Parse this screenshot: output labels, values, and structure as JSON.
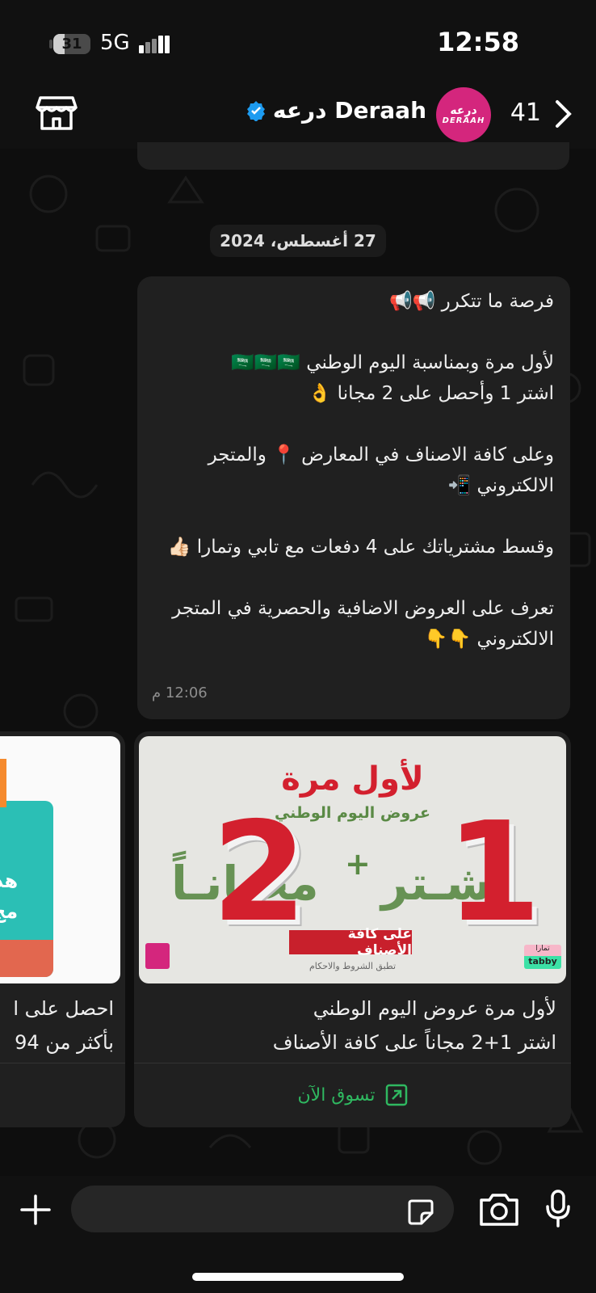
{
  "status_bar": {
    "battery": "31",
    "battery_percent": 31,
    "network": "5G",
    "time": "12:58"
  },
  "header": {
    "title": "Deraah درعه",
    "avatar_ar": "درعه",
    "avatar_en": "DERAAH",
    "unread_count": "41",
    "icons": [
      "store-icon",
      "verified-badge-icon",
      "back-chevron-icon"
    ]
  },
  "date_chip": "27 أغسطس، 2024",
  "message": {
    "lines": [
      "فرصة ما تتكرر 📢📢",
      "",
      "لأول مرة وبمناسبة اليوم الوطني 🇸🇦🇸🇦🇸🇦",
      "اشتر 1 وأحصل على 2 مجانا 👌",
      "",
      "وعلى كافة الاصناف في المعارض 📍 والمتجر الالكتروني 📲",
      "",
      "وقسط مشترياتك على 4 دفعات مع تابي وتمارا 👍🏻",
      "",
      "تعرف على العروض الاضافية والحصرية في المتجر الالكتروني 👇👇"
    ],
    "time": "12:06 م"
  },
  "cards": [
    {
      "promo": {
        "title": "لأول مرة",
        "subtitle": "عروض اليوم الوطني",
        "word_buy": "اشـتر",
        "num_buy": "1",
        "plus": "+",
        "word_free": "مجـانـاً",
        "num_free": "2",
        "all_categories": "على كافة الأصناف",
        "terms": "تطبق الشروط والاحكام",
        "tabby_top": "تمارا",
        "tabby": "tabby"
      },
      "caption_line1": "لأول مرة عروض اليوم الوطني",
      "caption_line2": "اشتر 1+2 مجاناً على كافة الأصناف",
      "cta_label": "تسوق الآن"
    },
    {
      "promo_text": "هد\nمج",
      "caption_line1": "احصل على ا",
      "caption_line2": "بأكثر من 94"
    }
  ],
  "composer": {
    "icons": [
      "plus-icon",
      "sticker-icon",
      "camera-icon",
      "microphone-icon"
    ]
  },
  "colors": {
    "background": "#0b0b0b",
    "bubble": "#202020",
    "accent_green": "#2fb860",
    "brand_pink": "#d4267d",
    "promo_red": "#d3202e",
    "verified_blue": "#1d9bf0"
  }
}
